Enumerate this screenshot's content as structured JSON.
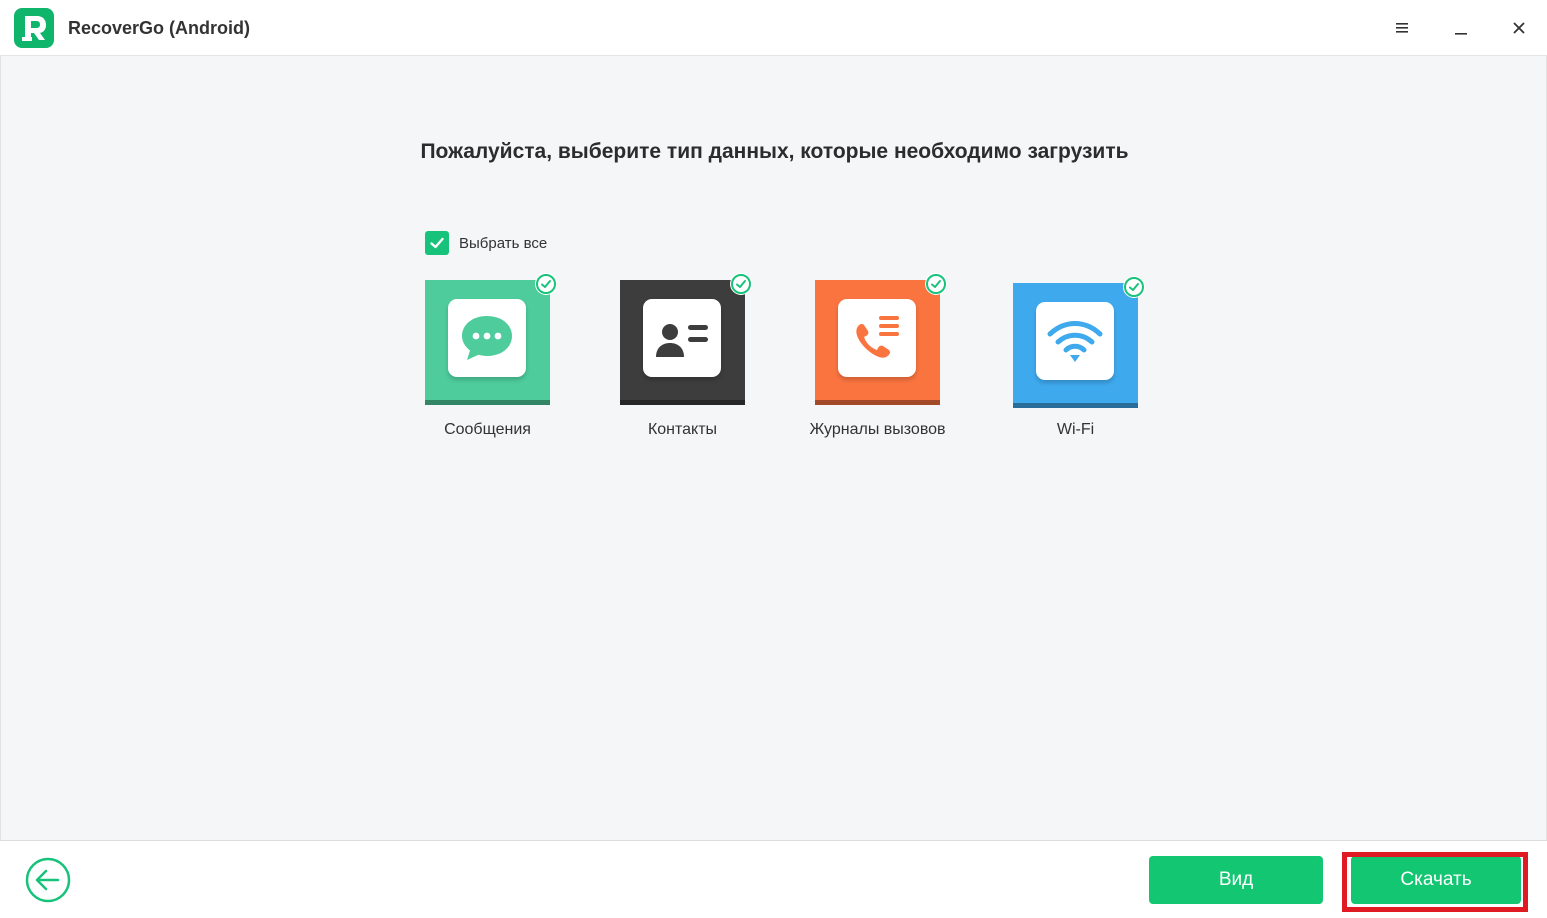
{
  "window": {
    "title": "RecoverGo (Android)",
    "logo_icon": "recovergo-logo-icon",
    "controls": [
      "menu-icon",
      "minimize-icon",
      "close-icon"
    ]
  },
  "main": {
    "heading": "Пожалуйста, выберите тип данных, которые необходимо загрузить",
    "select_all": {
      "label": "Выбрать все",
      "checked": true
    },
    "items": [
      {
        "label": "Сообщения",
        "icon": "message-icon",
        "color": "#4ecc9c",
        "checked": true
      },
      {
        "label": "Контакты",
        "icon": "contact-card-icon",
        "color": "#3d3d3d",
        "checked": true
      },
      {
        "label": "Журналы вызовов",
        "icon": "call-log-icon",
        "color": "#fa7440",
        "checked": true
      },
      {
        "label": "Wi-Fi",
        "icon": "wifi-icon",
        "color": "#3fa9ee",
        "checked": true
      }
    ]
  },
  "footer": {
    "back_icon": "back-arrow-icon",
    "view_label": "Вид",
    "download_label": "Скачать"
  },
  "colors": {
    "accent": "#12c672",
    "highlight": "#e01a22"
  }
}
